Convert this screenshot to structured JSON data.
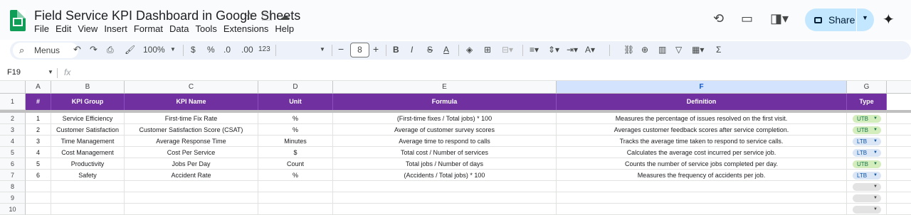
{
  "app": {
    "doc_title": "Field Service KPI Dashboard in Google Sheets",
    "menus": [
      "File",
      "Edit",
      "View",
      "Insert",
      "Format",
      "Data",
      "Tools",
      "Extensions",
      "Help"
    ],
    "share_label": "Share"
  },
  "toolbar": {
    "search_label": "Menus",
    "zoom": "100%",
    "currency": "$",
    "percent": "%",
    "dec_decrease": ".0",
    "dec_increase": ".00",
    "number_format": "123",
    "font_size": "8"
  },
  "formula_bar": {
    "cell_ref": "F19",
    "fx": "fx",
    "value": ""
  },
  "columns": [
    "A",
    "B",
    "C",
    "D",
    "E",
    "F",
    "G"
  ],
  "selected_column": "F",
  "row_numbers": [
    "1",
    "2",
    "3",
    "4",
    "5",
    "6",
    "7",
    "8",
    "9",
    "10"
  ],
  "table": {
    "headers": [
      "#",
      "KPI Group",
      "KPI Name",
      "Unit",
      "Formula",
      "Definition",
      "Type"
    ],
    "rows": [
      [
        "1",
        "Service Efficiency",
        "First-time Fix Rate",
        "%",
        "(First-time fixes / Total jobs) * 100",
        "Measures the percentage of issues resolved on the first visit.",
        "UTB"
      ],
      [
        "2",
        "Customer Satisfaction",
        "Customer Satisfaction Score (CSAT)",
        "%",
        "Average of customer survey scores",
        "Averages customer feedback scores after service completion.",
        "UTB"
      ],
      [
        "3",
        "Time Management",
        "Average Response Time",
        "Minutes",
        "Average time to respond to calls",
        "Tracks the average time taken to respond to service calls.",
        "LTB"
      ],
      [
        "4",
        "Cost Management",
        "Cost Per Service",
        "$",
        "Total cost / Number of services",
        "Calculates the average cost incurred per service job.",
        "LTB"
      ],
      [
        "5",
        "Productivity",
        "Jobs Per Day",
        "Count",
        "Total jobs / Number of days",
        "Counts the number of service jobs completed per day.",
        "UTB"
      ],
      [
        "6",
        "Safety",
        "Accident Rate",
        "%",
        "(Accidents / Total jobs) * 100",
        "Measures the frequency of accidents per job.",
        "LTB"
      ]
    ]
  },
  "colors": {
    "header_fill": "#7030a0",
    "utb_chip": "#d4edbc",
    "ltb_chip": "#dae6f5",
    "share_button": "#c2e7ff"
  }
}
